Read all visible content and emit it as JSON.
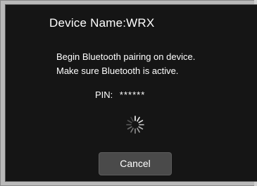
{
  "dialog": {
    "title": "Device Name:WRX",
    "message_line1": "Begin Bluetooth pairing on device.",
    "message_line2": "Make sure Bluetooth is active.",
    "pin_label": "PIN:",
    "pin_value": "******",
    "cancel_label": "Cancel"
  },
  "icons": {
    "spinner": "loading-spinner-icon"
  }
}
